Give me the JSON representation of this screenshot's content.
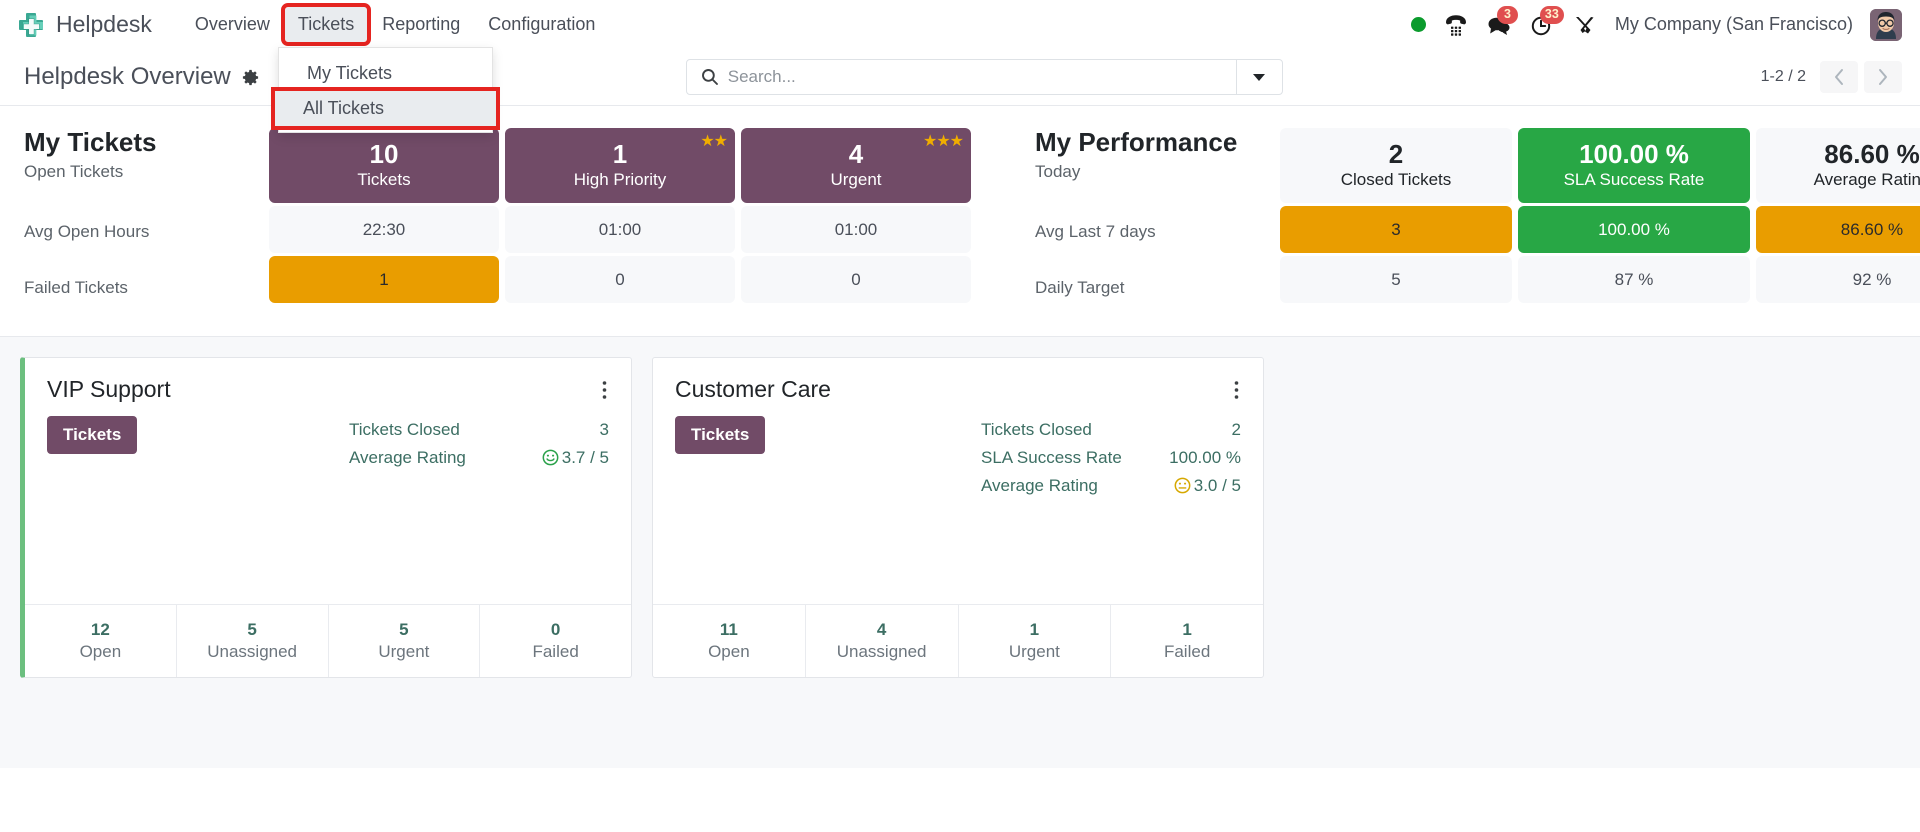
{
  "navbar": {
    "brand": "Helpdesk",
    "logo_icon": "helpdesk-cross-logo",
    "menu": [
      {
        "label": "Overview",
        "active": false
      },
      {
        "label": "Tickets",
        "active": true
      },
      {
        "label": "Reporting",
        "active": false
      },
      {
        "label": "Configuration",
        "active": false
      }
    ],
    "tray": {
      "status_icon": "green-status-dot",
      "phone_icon": "phone-dialpad-icon",
      "messages_icon": "chat-bubble-icon",
      "messages_count": "3",
      "activities_icon": "clock-activity-icon",
      "activities_count": "33",
      "tools_icon": "wrench-tools-icon",
      "company": "My Company (San Francisco)",
      "avatar_icon": "user-avatar"
    }
  },
  "dropdown": {
    "items": [
      {
        "label": "My Tickets",
        "highlighted": false
      },
      {
        "label": "All Tickets",
        "highlighted": true
      }
    ]
  },
  "control_panel": {
    "title": "Helpdesk Overview",
    "gear_icon": "gear-icon",
    "search": {
      "icon": "search-icon",
      "placeholder": "Search...",
      "value": "",
      "toggle_icon": "chevron-down-icon"
    },
    "pager": {
      "count": "1-2 / 2",
      "prev_icon": "chevron-left-icon",
      "next_icon": "chevron-right-icon"
    }
  },
  "my_tickets": {
    "title": "My Tickets",
    "row_labels": [
      "Open Tickets",
      "Avg Open Hours",
      "Failed Tickets"
    ],
    "columns": [
      {
        "value": "10",
        "caption": "Tickets",
        "stars": 0,
        "style": "purple",
        "avg_open_hours": "22:30",
        "avg_style": "plain",
        "failed": "1",
        "failed_style": "orange"
      },
      {
        "value": "1",
        "caption": "High Priority",
        "stars": 2,
        "style": "purple",
        "avg_open_hours": "01:00",
        "avg_style": "plain",
        "failed": "0",
        "failed_style": "plain"
      },
      {
        "value": "4",
        "caption": "Urgent",
        "stars": 3,
        "style": "purple",
        "avg_open_hours": "01:00",
        "avg_style": "plain",
        "failed": "0",
        "failed_style": "plain"
      }
    ]
  },
  "my_performance": {
    "title": "My Performance",
    "row_labels": [
      "Today",
      "Avg Last 7 days",
      "Daily Target"
    ],
    "columns": [
      {
        "value": "2",
        "caption": "Closed Tickets",
        "style": "plain",
        "avg7": "3",
        "avg7_style": "orange",
        "target": "5",
        "target_style": "plain"
      },
      {
        "value": "100.00 %",
        "caption": "SLA Success Rate",
        "style": "green",
        "avg7": "100.00 %",
        "avg7_style": "green",
        "target": "87 %",
        "target_style": "plain"
      },
      {
        "value": "86.60 %",
        "caption": "Average Rating",
        "style": "plain",
        "avg7": "86.60 %",
        "avg7_style": "orange",
        "target": "92 %",
        "target_style": "plain"
      }
    ]
  },
  "teams": [
    {
      "name": "VIP Support",
      "accent": "#6cbf7f",
      "has_accent": true,
      "button_label": "Tickets",
      "kebab_icon": "vertical-dots-icon",
      "stats": [
        {
          "key": "Tickets Closed",
          "value": "3",
          "emoji": ""
        },
        {
          "key": "Average Rating",
          "value": "3.7 / 5",
          "emoji": "happy-face-icon"
        }
      ],
      "footer": [
        {
          "num": "12",
          "label": "Open"
        },
        {
          "num": "5",
          "label": "Unassigned"
        },
        {
          "num": "5",
          "label": "Urgent"
        },
        {
          "num": "0",
          "label": "Failed"
        }
      ]
    },
    {
      "name": "Customer Care",
      "accent": "",
      "has_accent": false,
      "button_label": "Tickets",
      "kebab_icon": "vertical-dots-icon",
      "stats": [
        {
          "key": "Tickets Closed",
          "value": "2",
          "emoji": ""
        },
        {
          "key": "SLA Success Rate",
          "value": "100.00 %",
          "emoji": ""
        },
        {
          "key": "Average Rating",
          "value": "3.0 / 5",
          "emoji": "neutral-face-icon"
        }
      ],
      "footer": [
        {
          "num": "11",
          "label": "Open"
        },
        {
          "num": "4",
          "label": "Unassigned"
        },
        {
          "num": "1",
          "label": "Urgent"
        },
        {
          "num": "1",
          "label": "Failed"
        }
      ]
    }
  ],
  "colors": {
    "brand_purple": "#714b67",
    "success_green": "#28a745",
    "warning_orange": "#e99d00",
    "highlight_red": "#e52420",
    "teal_logo": "#35b5a0",
    "card_accent_green": "#6cbf7f"
  }
}
